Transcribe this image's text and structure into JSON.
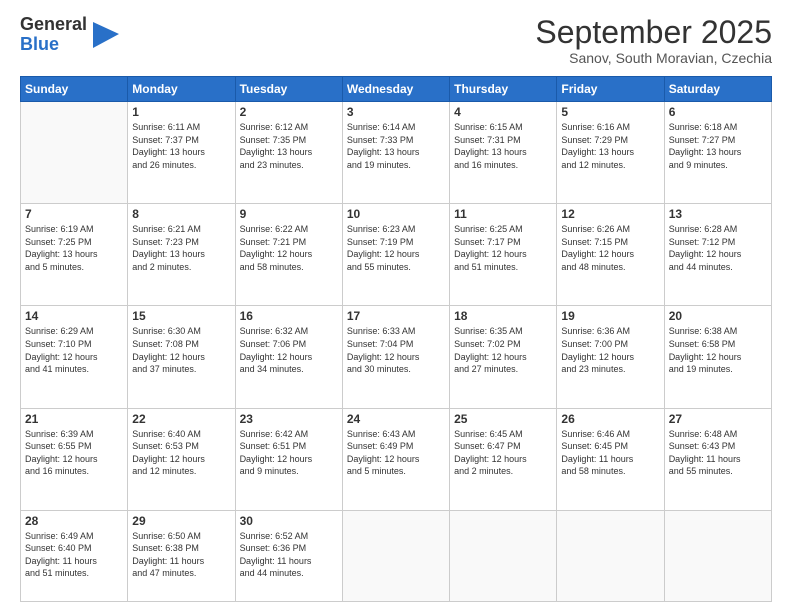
{
  "logo": {
    "line1": "General",
    "line2": "Blue"
  },
  "header": {
    "month": "September 2025",
    "location": "Sanov, South Moravian, Czechia"
  },
  "weekdays": [
    "Sunday",
    "Monday",
    "Tuesday",
    "Wednesday",
    "Thursday",
    "Friday",
    "Saturday"
  ],
  "weeks": [
    [
      {
        "day": "",
        "text": ""
      },
      {
        "day": "1",
        "text": "Sunrise: 6:11 AM\nSunset: 7:37 PM\nDaylight: 13 hours\nand 26 minutes."
      },
      {
        "day": "2",
        "text": "Sunrise: 6:12 AM\nSunset: 7:35 PM\nDaylight: 13 hours\nand 23 minutes."
      },
      {
        "day": "3",
        "text": "Sunrise: 6:14 AM\nSunset: 7:33 PM\nDaylight: 13 hours\nand 19 minutes."
      },
      {
        "day": "4",
        "text": "Sunrise: 6:15 AM\nSunset: 7:31 PM\nDaylight: 13 hours\nand 16 minutes."
      },
      {
        "day": "5",
        "text": "Sunrise: 6:16 AM\nSunset: 7:29 PM\nDaylight: 13 hours\nand 12 minutes."
      },
      {
        "day": "6",
        "text": "Sunrise: 6:18 AM\nSunset: 7:27 PM\nDaylight: 13 hours\nand 9 minutes."
      }
    ],
    [
      {
        "day": "7",
        "text": "Sunrise: 6:19 AM\nSunset: 7:25 PM\nDaylight: 13 hours\nand 5 minutes."
      },
      {
        "day": "8",
        "text": "Sunrise: 6:21 AM\nSunset: 7:23 PM\nDaylight: 13 hours\nand 2 minutes."
      },
      {
        "day": "9",
        "text": "Sunrise: 6:22 AM\nSunset: 7:21 PM\nDaylight: 12 hours\nand 58 minutes."
      },
      {
        "day": "10",
        "text": "Sunrise: 6:23 AM\nSunset: 7:19 PM\nDaylight: 12 hours\nand 55 minutes."
      },
      {
        "day": "11",
        "text": "Sunrise: 6:25 AM\nSunset: 7:17 PM\nDaylight: 12 hours\nand 51 minutes."
      },
      {
        "day": "12",
        "text": "Sunrise: 6:26 AM\nSunset: 7:15 PM\nDaylight: 12 hours\nand 48 minutes."
      },
      {
        "day": "13",
        "text": "Sunrise: 6:28 AM\nSunset: 7:12 PM\nDaylight: 12 hours\nand 44 minutes."
      }
    ],
    [
      {
        "day": "14",
        "text": "Sunrise: 6:29 AM\nSunset: 7:10 PM\nDaylight: 12 hours\nand 41 minutes."
      },
      {
        "day": "15",
        "text": "Sunrise: 6:30 AM\nSunset: 7:08 PM\nDaylight: 12 hours\nand 37 minutes."
      },
      {
        "day": "16",
        "text": "Sunrise: 6:32 AM\nSunset: 7:06 PM\nDaylight: 12 hours\nand 34 minutes."
      },
      {
        "day": "17",
        "text": "Sunrise: 6:33 AM\nSunset: 7:04 PM\nDaylight: 12 hours\nand 30 minutes."
      },
      {
        "day": "18",
        "text": "Sunrise: 6:35 AM\nSunset: 7:02 PM\nDaylight: 12 hours\nand 27 minutes."
      },
      {
        "day": "19",
        "text": "Sunrise: 6:36 AM\nSunset: 7:00 PM\nDaylight: 12 hours\nand 23 minutes."
      },
      {
        "day": "20",
        "text": "Sunrise: 6:38 AM\nSunset: 6:58 PM\nDaylight: 12 hours\nand 19 minutes."
      }
    ],
    [
      {
        "day": "21",
        "text": "Sunrise: 6:39 AM\nSunset: 6:55 PM\nDaylight: 12 hours\nand 16 minutes."
      },
      {
        "day": "22",
        "text": "Sunrise: 6:40 AM\nSunset: 6:53 PM\nDaylight: 12 hours\nand 12 minutes."
      },
      {
        "day": "23",
        "text": "Sunrise: 6:42 AM\nSunset: 6:51 PM\nDaylight: 12 hours\nand 9 minutes."
      },
      {
        "day": "24",
        "text": "Sunrise: 6:43 AM\nSunset: 6:49 PM\nDaylight: 12 hours\nand 5 minutes."
      },
      {
        "day": "25",
        "text": "Sunrise: 6:45 AM\nSunset: 6:47 PM\nDaylight: 12 hours\nand 2 minutes."
      },
      {
        "day": "26",
        "text": "Sunrise: 6:46 AM\nSunset: 6:45 PM\nDaylight: 11 hours\nand 58 minutes."
      },
      {
        "day": "27",
        "text": "Sunrise: 6:48 AM\nSunset: 6:43 PM\nDaylight: 11 hours\nand 55 minutes."
      }
    ],
    [
      {
        "day": "28",
        "text": "Sunrise: 6:49 AM\nSunset: 6:40 PM\nDaylight: 11 hours\nand 51 minutes."
      },
      {
        "day": "29",
        "text": "Sunrise: 6:50 AM\nSunset: 6:38 PM\nDaylight: 11 hours\nand 47 minutes."
      },
      {
        "day": "30",
        "text": "Sunrise: 6:52 AM\nSunset: 6:36 PM\nDaylight: 11 hours\nand 44 minutes."
      },
      {
        "day": "",
        "text": ""
      },
      {
        "day": "",
        "text": ""
      },
      {
        "day": "",
        "text": ""
      },
      {
        "day": "",
        "text": ""
      }
    ]
  ]
}
